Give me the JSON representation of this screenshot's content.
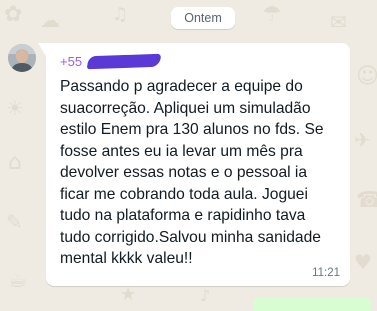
{
  "chat": {
    "date_separator": "Ontem",
    "messages": [
      {
        "direction": "incoming",
        "sender_prefix": "+55",
        "sender_redacted": true,
        "text": "Passando p agradecer a equipe do\nsuacorreção. Apliquei um simuladão\nestilo Enem pra 130 alunos no fds. Se\nfosse antes eu ia levar um mês pra\ndevolver essas notas e o pessoal ia\nficar me cobrando toda aula. Joguei\ntudo na plataforma e rapidinho tava\ntudo corrigido.Salvou minha sanidade\nmental kkkk valeu!!",
        "time": "11:21"
      }
    ]
  },
  "colors": {
    "wallpaper": "#efeae2",
    "incoming_bubble": "#ffffff",
    "outgoing_bubble": "#d9fdd3",
    "sender_name": "#a55bd6",
    "redaction": "#5a39d6"
  },
  "icons": {
    "avatar": "contact-avatar"
  }
}
